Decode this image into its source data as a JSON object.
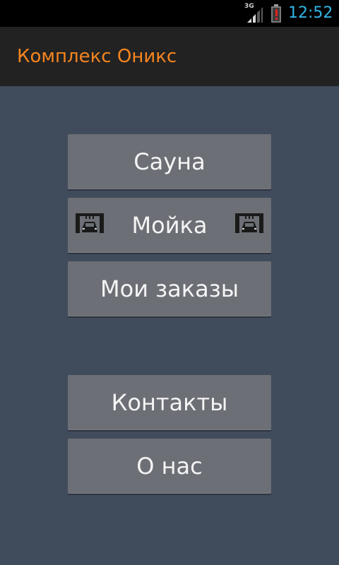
{
  "status_bar": {
    "network": "3G",
    "time": "12:52",
    "icons": [
      "signal-icon",
      "battery-alert-icon"
    ]
  },
  "action_bar": {
    "title": "Комплекс Оникс"
  },
  "menu": {
    "sauna": "Сауна",
    "carwash": "Мойка",
    "orders": "Мои заказы",
    "contacts": "Контакты",
    "about": "О нас"
  },
  "colors": {
    "background": "#404b5c",
    "action_bar": "#222222",
    "title": "#f6851f",
    "clock": "#33b5e5",
    "button": "#6c6f75"
  }
}
